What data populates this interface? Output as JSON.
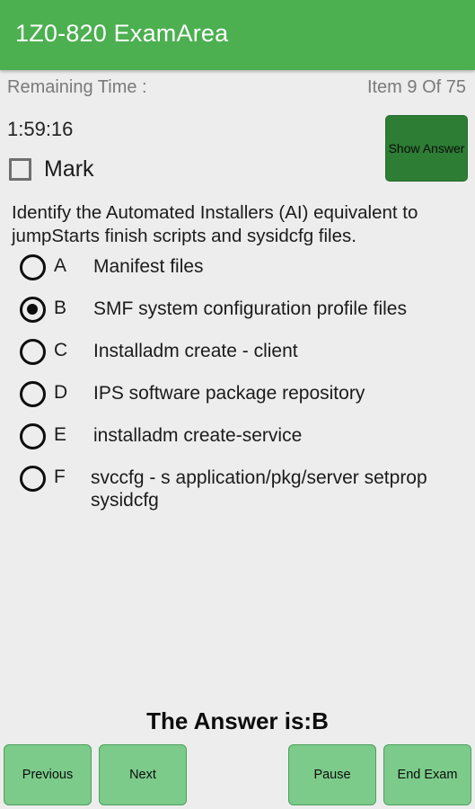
{
  "appbar": {
    "title": "1Z0-820 ExamArea",
    "bg_color": "#4CAF50"
  },
  "status": {
    "remaining_time_label": "Remaining Time :",
    "item_counter": "Item  9  Of  75",
    "timer_value": "1:59:16"
  },
  "mark": {
    "label": "Mark",
    "checked": false
  },
  "show_answer": {
    "label": "Show Answer",
    "bg_color": "#2d7d34"
  },
  "question": {
    "text": "Identify the Automated Installers (AI) equivalent to jumpStarts finish scripts and sysidcfg files.",
    "options": [
      {
        "letter": "A",
        "text": "Manifest files",
        "selected": false
      },
      {
        "letter": "B",
        "text": "SMF system configuration profile files",
        "selected": true
      },
      {
        "letter": "C",
        "text": "Installadm create - client",
        "selected": false
      },
      {
        "letter": "D",
        "text": "IPS software package repository",
        "selected": false
      },
      {
        "letter": "E",
        "text": "installadm create-service",
        "selected": false
      },
      {
        "letter": "F",
        "text": "svccfg - s application/pkg/server setprop sysidcfg",
        "selected": false
      }
    ]
  },
  "answer": {
    "text": "The Answer is:B"
  },
  "bottom_bar": {
    "previous_label": "Previous",
    "next_label": "Next",
    "pause_label": "Pause",
    "end_exam_label": "End Exam",
    "button_color": "#7ccb8a"
  }
}
